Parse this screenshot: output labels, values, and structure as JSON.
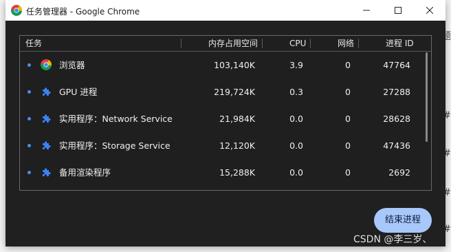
{
  "window": {
    "title": "任务管理器 - Google Chrome"
  },
  "table": {
    "columns": {
      "task": "任务",
      "memory": "内存占用空间",
      "cpu": "CPU",
      "network": "网络",
      "pid": "进程 ID"
    },
    "rows": [
      {
        "name": "浏览器",
        "icon": "chrome-icon",
        "memory": "103,140K",
        "cpu": "3.9",
        "network": "0",
        "pid": "47764"
      },
      {
        "name": "GPU 进程",
        "icon": "puzzle-piece-icon",
        "memory": "219,724K",
        "cpu": "0.3",
        "network": "0",
        "pid": "27288"
      },
      {
        "name": "实用程序：Network Service",
        "icon": "puzzle-piece-icon",
        "memory": "21,984K",
        "cpu": "0.0",
        "network": "0",
        "pid": "28628"
      },
      {
        "name": "实用程序：Storage Service",
        "icon": "puzzle-piece-icon",
        "memory": "12,120K",
        "cpu": "0.0",
        "network": "0",
        "pid": "47436"
      },
      {
        "name": "备用渲染程序",
        "icon": "puzzle-piece-icon",
        "memory": "15,288K",
        "cpu": "0.0",
        "network": "0",
        "pid": "2692"
      }
    ]
  },
  "actions": {
    "end_process": "结束进程"
  },
  "watermark": "CSDN @李三岁、",
  "background_glyphs": [
    "题",
    "#",
    "#",
    "#",
    "#"
  ],
  "colors": {
    "window_bg": "#202020",
    "titlebar_bg": "#ffffff",
    "accent_button": "#a8c7fa",
    "bullet": "#4a8fe8",
    "puzzle_icon": "#3b82f6"
  }
}
